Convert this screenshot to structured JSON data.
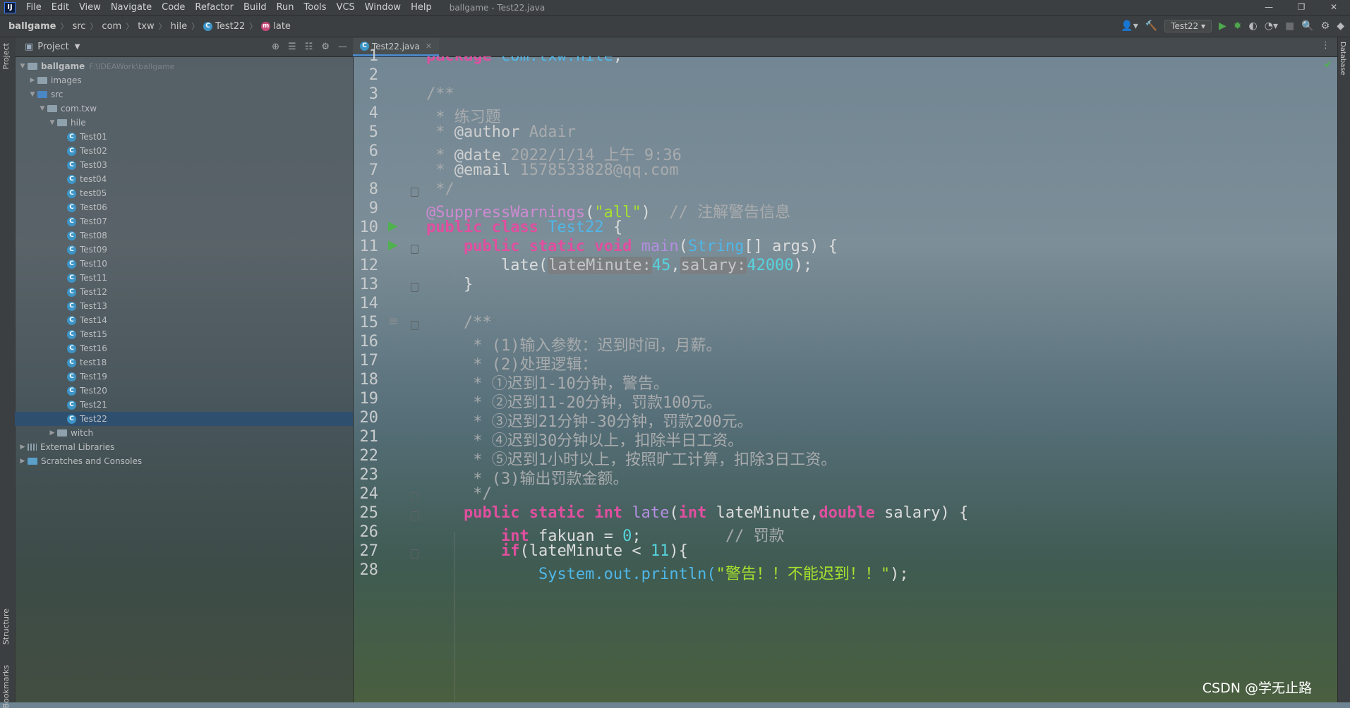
{
  "menubar": {
    "logo": "IJ",
    "items": [
      "File",
      "Edit",
      "View",
      "Navigate",
      "Code",
      "Refactor",
      "Build",
      "Run",
      "Tools",
      "VCS",
      "Window",
      "Help"
    ],
    "window_title": "ballgame - Test22.java",
    "controls": [
      "—",
      "❐",
      "✕"
    ]
  },
  "navbar": {
    "crumbs": [
      "ballgame",
      "src",
      "com",
      "txw",
      "hile",
      "Test22",
      "late"
    ],
    "run_config": "Test22"
  },
  "left_strip": {
    "project_tab": "Project",
    "structure_tab": "Structure",
    "bookmarks_tab": "Bookmarks"
  },
  "right_strip": {
    "database_tab": "Database"
  },
  "project": {
    "header": "Project",
    "root": {
      "name": "ballgame",
      "path": "F:\\IDEAWork\\ballgame"
    },
    "images": "images",
    "src": "src",
    "package": "com.txw",
    "subpackage": "hile",
    "classes": [
      "Test01",
      "Test02",
      "Test03",
      "test04",
      "test05",
      "Test06",
      "Test07",
      "Test08",
      "Test09",
      "Test10",
      "Test11",
      "Test12",
      "Test13",
      "Test14",
      "Test15",
      "Test16",
      "test18",
      "Test19",
      "Test20",
      "Test21",
      "Test22"
    ],
    "selected": "Test22",
    "witch": "witch",
    "external_libraries": "External Libraries",
    "scratches": "Scratches and Consoles"
  },
  "editor": {
    "tab": "Test22.java",
    "line_numbers": [
      "1",
      "2",
      "3",
      "4",
      "5",
      "6",
      "7",
      "8",
      "9",
      "10",
      "11",
      "12",
      "13",
      "14",
      "15",
      "16",
      "17",
      "18",
      "19",
      "20",
      "21",
      "22",
      "23",
      "24",
      "25",
      "26",
      "27",
      "28"
    ],
    "code": {
      "l1_kw": "package ",
      "l1_pkg": "com.txw.hile",
      "l1_end": ";",
      "l3": "/**",
      "l4": " * 练习题",
      "l5_star": " * ",
      "l5_tag": "@author",
      "l5_val": " Adair",
      "l6_star": " * ",
      "l6_tag": "@date",
      "l6_val": " 2022/1/14 上午 9:36",
      "l7_star": " * ",
      "l7_tag": "@email",
      "l7_val": " 1578533828@qq.com",
      "l8": " */",
      "l9_ann": "@SuppressWarnings",
      "l9_p1": "(",
      "l9_str": "\"all\"",
      "l9_p2": ")  ",
      "l9_cmt": "// 注解警告信息",
      "l10_kw": "public class ",
      "l10_name": "Test22",
      "l10_end": " {",
      "l11_ind": "    ",
      "l11_kw": "public static void ",
      "l11_fn": "main",
      "l11_p": "(",
      "l11_typ": "String",
      "l11_rest": "[] args) {",
      "l12_ind": "        ",
      "l12_call": "late(",
      "l12_h1": "lateMinute:",
      "l12_n1": "45",
      "l12_c": ",",
      "l12_h2": "salary:",
      "l12_n2": "42000",
      "l12_end": ");",
      "l13": "    }",
      "l15": "    /**",
      "l16": "     * (1)输入参数：迟到时间，月薪。",
      "l17": "     * (2)处理逻辑：",
      "l18": "     * ①迟到1-10分钟，警告。",
      "l19": "     * ②迟到11-20分钟，罚款100元。",
      "l20": "     * ③迟到21分钟-30分钟，罚款200元。",
      "l21": "     * ④迟到30分钟以上，扣除半日工资。",
      "l22": "     * ⑤迟到1小时以上，按照旷工计算，扣除3日工资。",
      "l23": "     * (3)输出罚款金额。",
      "l24": "     */",
      "l25_ind": "    ",
      "l25_kw": "public static int ",
      "l25_fn": "late",
      "l25_p": "(",
      "l25_kw2": "int",
      "l25_a": " lateMinute,",
      "l25_kw3": "double",
      "l25_b": " salary) {",
      "l26_ind": "        ",
      "l26_kw": "int",
      "l26_a": " fakuan = ",
      "l26_num": "0",
      "l26_b": ";         ",
      "l26_cmt": "// 罚款",
      "l27_ind": "        ",
      "l27_kw": "if",
      "l27_a": "(lateMinute < ",
      "l27_num": "11",
      "l27_b": "){",
      "l28_ind": "            ",
      "l28_a": "System.out.println(",
      "l28_str": "\"警告！！不能迟到！！\"",
      "l28_b": ");"
    }
  },
  "watermark": "CSDN @学无止路",
  "colors": {
    "keyword": "#e04f9f",
    "package": "#4fb7e8",
    "string": "#a6e22e",
    "number": "#56d4dd",
    "annotation": "#cf8ad2",
    "selection": "#2f4f6f"
  }
}
